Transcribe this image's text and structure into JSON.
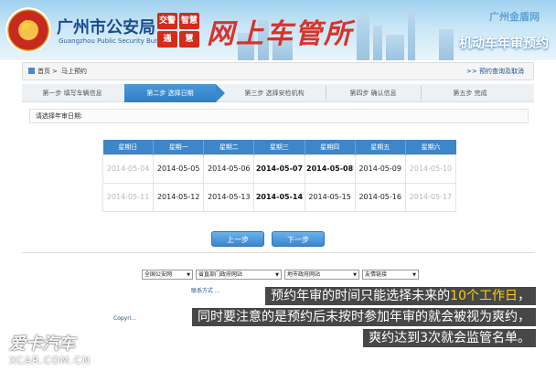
{
  "header": {
    "org_title": "广州市公安局",
    "org_subtitle": "Guangzhou Public Security Bureau",
    "seal_1": "交警",
    "seal_2": "智慧",
    "seal_3": "通",
    "seal_4": "慧",
    "brush_title": "网上车管所",
    "corner_logo": "广州金盾网",
    "banner_title": "机动车年审预约"
  },
  "nav": {
    "home": "首页",
    "sep": ">",
    "current": "马上预约",
    "query_link": ">> 预约查询及取消"
  },
  "steps": [
    {
      "label": "第一步  填写车辆信息"
    },
    {
      "label": "第二步  选择日期"
    },
    {
      "label": "第三步  选择安检机构"
    },
    {
      "label": "第四步  确认信息"
    },
    {
      "label": "第五步  完成"
    }
  ],
  "pick_label": "请选择年审日期:",
  "calendar": {
    "headers": [
      "星期日",
      "星期一",
      "星期二",
      "星期三",
      "星期四",
      "星期五",
      "星期六"
    ],
    "rows": [
      [
        "2014-05-04",
        "2014-05-05",
        "2014-05-06",
        "2014-05-07",
        "2014-05-08",
        "2014-05-09",
        "2014-05-10"
      ],
      [
        "2014-05-11",
        "2014-05-12",
        "2014-05-13",
        "2014-05-14",
        "2014-05-15",
        "2014-05-16",
        "2014-05-17"
      ]
    ]
  },
  "buttons": {
    "prev": "上一步",
    "next": "下一步"
  },
  "footer": {
    "select_1": "全国公安网",
    "select_2": "省直部门政府网站",
    "select_3": "地市政府网站",
    "select_4": "友情链接",
    "contact": "联系方式  ...",
    "copyright": "Copyri..."
  },
  "captions": {
    "line1_a": "预约年审的时间只能选择未来的",
    "line1_hl": "10个工作日",
    "line1_b": "，",
    "line2": "同时要注意的是预约后未按时参加年审的就会被视为爽约，",
    "line3": "爽约达到3次就会监管名单。"
  },
  "watermark": {
    "logo": "爱卡汽车",
    "site": "XCAR.COM.CN"
  },
  "colors": {
    "accent": "#3d86c9",
    "banner_red": "#d8332a",
    "highlight": "#ffd400"
  }
}
